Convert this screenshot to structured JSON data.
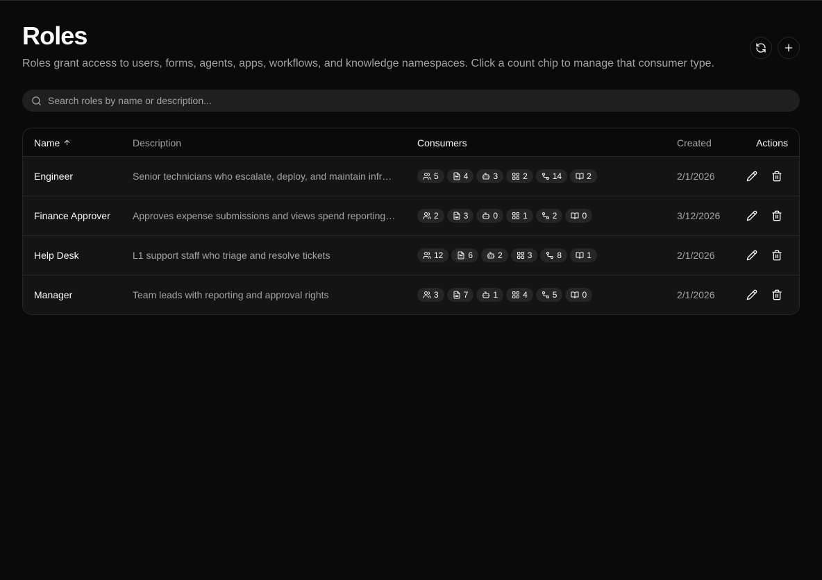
{
  "page": {
    "title": "Roles",
    "subtitle": "Roles grant access to users, forms, agents, apps, workflows, and knowledge namespaces. Click a count chip to manage that consumer type."
  },
  "search": {
    "placeholder": "Search roles by name or description..."
  },
  "columns": {
    "name": "Name",
    "description": "Description",
    "consumers": "Consumers",
    "created": "Created",
    "actions": "Actions"
  },
  "rows": [
    {
      "name": "Engineer",
      "description": "Senior technicians who escalate, deploy, and maintain infrastructure",
      "users": "5",
      "forms": "4",
      "agents": "3",
      "apps": "2",
      "workflows": "14",
      "knowledge": "2",
      "created": "2/1/2026"
    },
    {
      "name": "Finance Approver",
      "description": "Approves expense submissions and views spend reporting dashboards",
      "users": "2",
      "forms": "3",
      "agents": "0",
      "apps": "1",
      "workflows": "2",
      "knowledge": "0",
      "created": "3/12/2026"
    },
    {
      "name": "Help Desk",
      "description": "L1 support staff who triage and resolve tickets",
      "users": "12",
      "forms": "6",
      "agents": "2",
      "apps": "3",
      "workflows": "8",
      "knowledge": "1",
      "created": "2/1/2026"
    },
    {
      "name": "Manager",
      "description": "Team leads with reporting and approval rights",
      "users": "3",
      "forms": "7",
      "agents": "1",
      "apps": "4",
      "workflows": "5",
      "knowledge": "0",
      "created": "2/1/2026"
    }
  ]
}
